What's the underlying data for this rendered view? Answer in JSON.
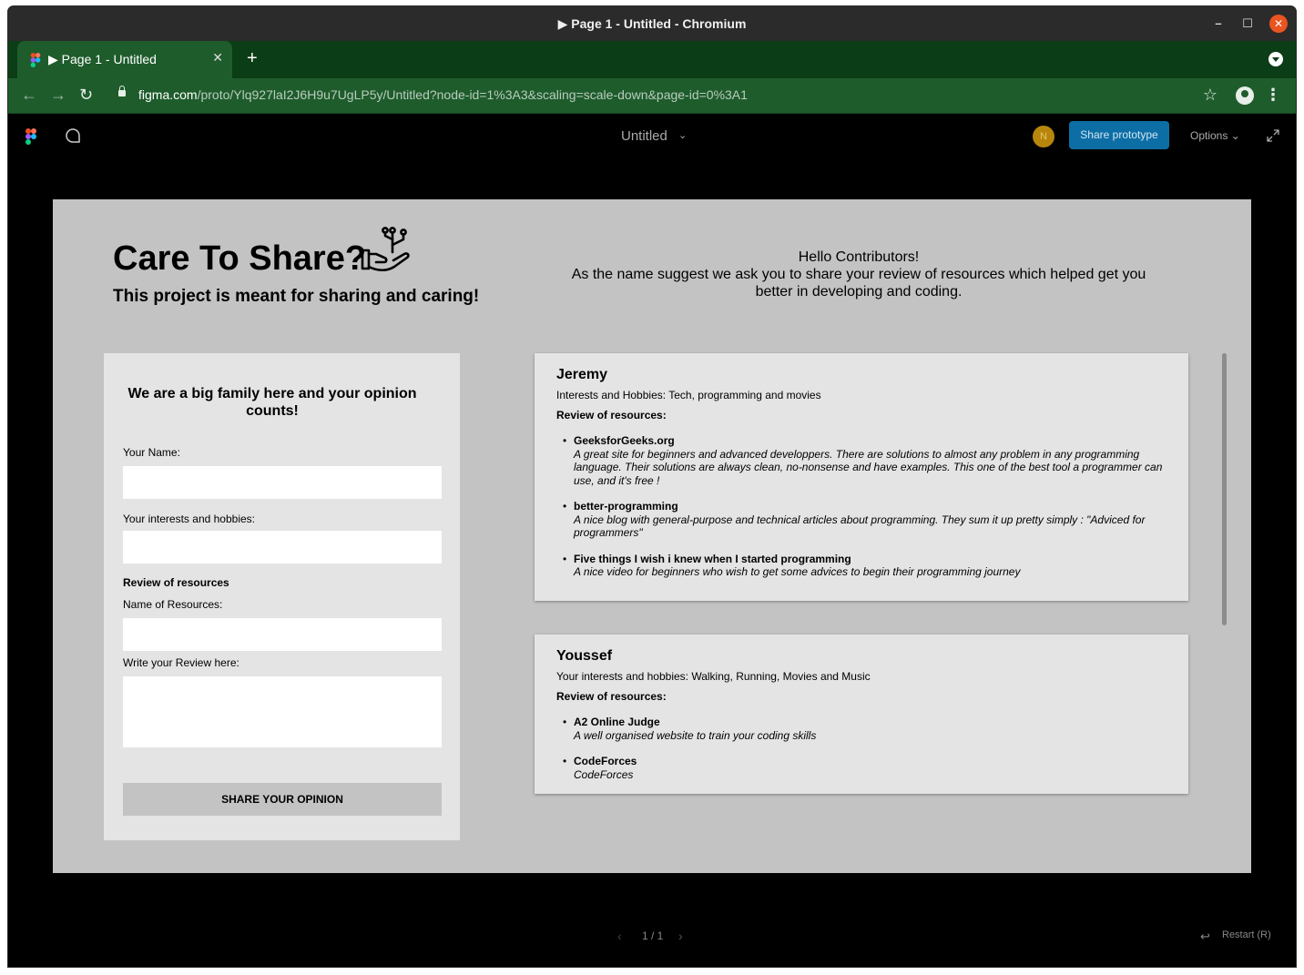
{
  "window": {
    "title": "▶ Page 1 - Untitled - Chromium",
    "controls": {
      "minimize": "–",
      "maximize": "☐",
      "close": "✕"
    }
  },
  "browser": {
    "tab_label": "▶ Page 1 - Untitled",
    "tab_close": "✕",
    "new_tab": "+",
    "url_host": "figma.com",
    "url_path": "/proto/Ylq927laI2J6H9u7UgLP5y/Untitled?node-id=1%3A3&scaling=scale-down&page-id=0%3A1",
    "nav": {
      "back": "←",
      "forward": "→",
      "reload": "↻",
      "star": "☆",
      "menu": "⋮"
    }
  },
  "figma": {
    "file_title": "Untitled",
    "file_chevron": "⌄",
    "avatar_initial": "N",
    "share_label": "Share prototype",
    "options_label": "Options ⌄",
    "colors": {
      "share_button": "#0d6ea5",
      "avatar": "#b8860b",
      "frame_bg": "#c3c3c3",
      "card_bg": "#e4e4e4"
    }
  },
  "page": {
    "headline": "Care To Share?",
    "tagline": "This project is meant for sharing and caring!",
    "welcome_lines": [
      "Hello Contributors!",
      "As the name suggest we ask you to share your review of resources which helped get you better in developing and coding."
    ]
  },
  "form": {
    "heading": "We are a big family here and your opinion counts!",
    "name_label": "Your Name:",
    "interests_label": "Your interests and hobbies:",
    "review_section": "Review of resources",
    "resource_label": "Name of Resources:",
    "review_label": "Write your Review here:",
    "submit_label": "SHARE YOUR OPINION",
    "name_value": "",
    "interests_value": "",
    "resource_value": "",
    "review_value": ""
  },
  "reviews": [
    {
      "name": "Jeremy",
      "interests": "Interests and Hobbies: Tech, programming and movies",
      "review_heading": "Review of resources:",
      "items": [
        {
          "title": "GeeksforGeeks.org",
          "desc": "A great site for beginners and advanced developpers. There are solutions to almost any problem in any programming language. Their solutions are always clean, no-nonsense and have examples. This one of the best tool a programmer can use, and it's free !"
        },
        {
          "title": "better-programming",
          "desc": "A nice blog with general-purpose and technical articles about programming. They sum it up pretty simply : \"Adviced for programmers\""
        },
        {
          "title": "Five things I wish i knew when I started programming",
          "desc": "A nice video for beginners who wish to get some advices to begin their programming journey"
        }
      ]
    },
    {
      "name": "Youssef",
      "interests": "Your interests and hobbies: Walking, Running, Movies and Music",
      "review_heading": "Review of resources:",
      "items": [
        {
          "title": "A2 Online Judge",
          "desc": "A well organised website to train your coding skills"
        },
        {
          "title": "CodeForces",
          "desc": "CodeForces"
        }
      ]
    }
  ],
  "footer": {
    "prev": "‹",
    "page_indicator": "1 / 1",
    "next": "›",
    "restart_icon": "↩",
    "restart_label": "Restart (R)"
  }
}
